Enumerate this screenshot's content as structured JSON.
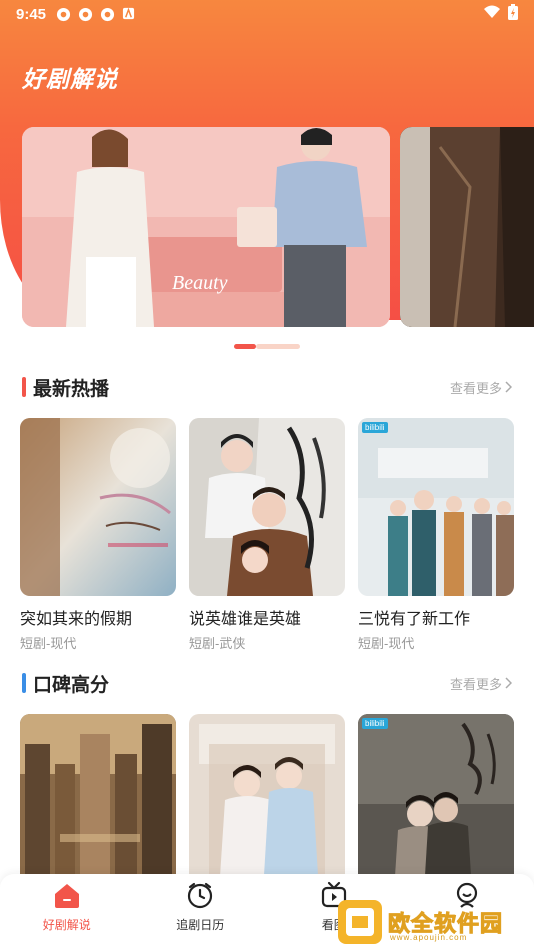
{
  "status_bar": {
    "time": "9:45"
  },
  "header": {
    "app_title": "好剧解说"
  },
  "banner": {
    "slides": [
      {
        "label": "Beauty"
      },
      {
        "label": ""
      }
    ],
    "active_index": 0
  },
  "sections": [
    {
      "title": "最新热播",
      "accent": "#f2554a",
      "more_label": "查看更多",
      "items": [
        {
          "title": "突如其来的假期",
          "subtitle": "短剧-现代"
        },
        {
          "title": "说英雄谁是英雄",
          "subtitle": "短剧-武侠"
        },
        {
          "title": "三悦有了新工作",
          "subtitle": "短剧-现代"
        }
      ]
    },
    {
      "title": "口碑高分",
      "accent": "#3a8ee6",
      "more_label": "查看更多",
      "items": [
        {
          "title": "",
          "subtitle": ""
        },
        {
          "title": "",
          "subtitle": ""
        },
        {
          "title": "",
          "subtitle": ""
        }
      ]
    }
  ],
  "bottom_nav": [
    {
      "label": "好剧解说",
      "icon": "home-icon",
      "active": true
    },
    {
      "label": "追剧日历",
      "icon": "clock-icon",
      "active": false
    },
    {
      "label": "看图",
      "icon": "tv-icon",
      "active": false
    },
    {
      "label": "",
      "icon": "profile-icon",
      "active": false
    }
  ],
  "watermark": {
    "text": "欧全软件园",
    "url": "www.apoujin.com"
  },
  "colors": {
    "brand": "#f2554a",
    "header_top": "#f7873f",
    "blue_accent": "#3a8ee6"
  }
}
